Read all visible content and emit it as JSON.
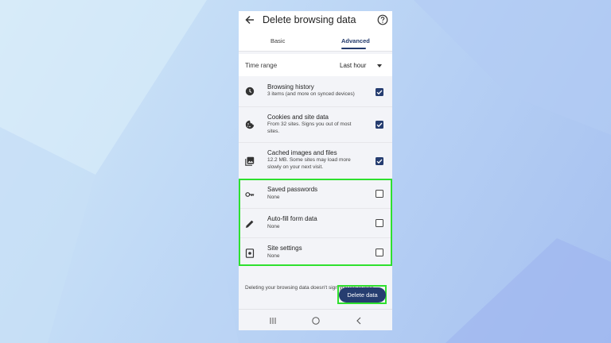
{
  "header": {
    "title": "Delete browsing data"
  },
  "tabs": [
    {
      "label": "Basic"
    },
    {
      "label": "Advanced"
    }
  ],
  "time_range": {
    "label": "Time range",
    "value": "Last hour"
  },
  "items": [
    {
      "title": "Browsing history",
      "subtitle": "3 items (and more on synced devices)",
      "checked": true,
      "icon": "clock-icon"
    },
    {
      "title": "Cookies and site data",
      "subtitle": "From 32 sites. Signs you out of most sites.",
      "checked": true,
      "icon": "cookie-icon"
    },
    {
      "title": "Cached images and files",
      "subtitle": "12.2 MB. Some sites may load more slowly on your next visit.",
      "checked": true,
      "icon": "image-icon"
    },
    {
      "title": "Saved passwords",
      "subtitle": "None",
      "checked": false,
      "icon": "key-icon"
    },
    {
      "title": "Auto-fill form data",
      "subtitle": "None",
      "checked": false,
      "icon": "pencil-icon"
    },
    {
      "title": "Site settings",
      "subtitle": "None",
      "checked": false,
      "icon": "site-settings-icon"
    }
  ],
  "footer_note": "Deleting your browsing data doesn't sign you out of your",
  "delete_button": "Delete data",
  "colors": {
    "accent": "#263d70",
    "highlight": "#2ee02e"
  }
}
